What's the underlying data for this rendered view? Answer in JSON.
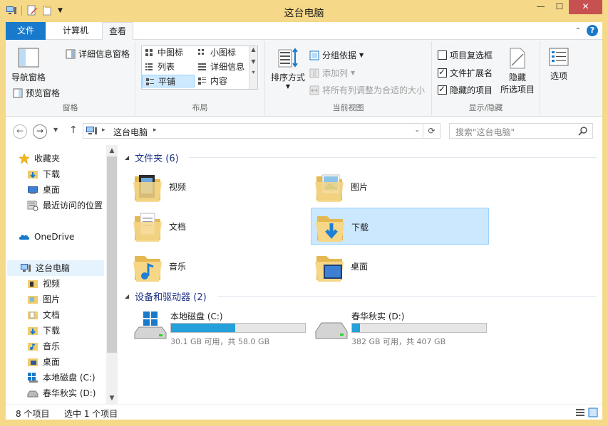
{
  "window": {
    "title": "这台电脑"
  },
  "tabs": {
    "file": "文件",
    "computer": "计算机",
    "view": "查看"
  },
  "ribbon": {
    "panes": {
      "nav_pane": "导航窗格",
      "preview_pane": "预览窗格",
      "details_pane": "详细信息窗格",
      "label": "窗格"
    },
    "layout": {
      "label": "布局",
      "cells": [
        "中图标",
        "小图标",
        "列表",
        "详细信息",
        "平铺",
        "内容"
      ],
      "selected": "平铺"
    },
    "current_view": {
      "sort": "排序方式",
      "group_by": "分组依据",
      "add_column": "添加列",
      "fit_columns": "将所有列调整为合适的大小",
      "label": "当前视图"
    },
    "show_hide": {
      "item_checkbox": "项目复选框",
      "file_ext": "文件扩展名",
      "hidden_items": "隐藏的项目",
      "hide_line1": "隐藏",
      "hide_line2": "所选项目",
      "label": "显示/隐藏"
    },
    "options": "选项"
  },
  "address": {
    "path": "这台电脑",
    "search_placeholder": "搜索\"这台电脑\""
  },
  "nav": {
    "favorites": "收藏夹",
    "fav_items": [
      "下载",
      "桌面",
      "最近访问的位置"
    ],
    "onedrive": "OneDrive",
    "thispc": "这台电脑",
    "pc_items": [
      "视频",
      "图片",
      "文档",
      "下载",
      "音乐",
      "桌面",
      "本地磁盘 (C:)",
      "春华秋实 (D:)"
    ]
  },
  "content": {
    "folders_header": "文件夹 (6)",
    "folders": [
      "视频",
      "图片",
      "文档",
      "下载",
      "音乐",
      "桌面"
    ],
    "drives_header": "设备和驱动器 (2)",
    "drives": [
      {
        "name": "本地磁盘 (C:)",
        "space": "30.1 GB 可用，共 58.0 GB",
        "used_fraction": 0.48
      },
      {
        "name": "春华秋实 (D:)",
        "space": "382 GB 可用，共 407 GB",
        "used_fraction": 0.06
      }
    ]
  },
  "status": {
    "items": "8 个项目",
    "selected": "选中 1 个项目"
  },
  "colors": {
    "accent": "#1979ca",
    "title_bg": "#f6d889",
    "drive_fill": "#26a0da",
    "selection": "#cce8ff"
  }
}
